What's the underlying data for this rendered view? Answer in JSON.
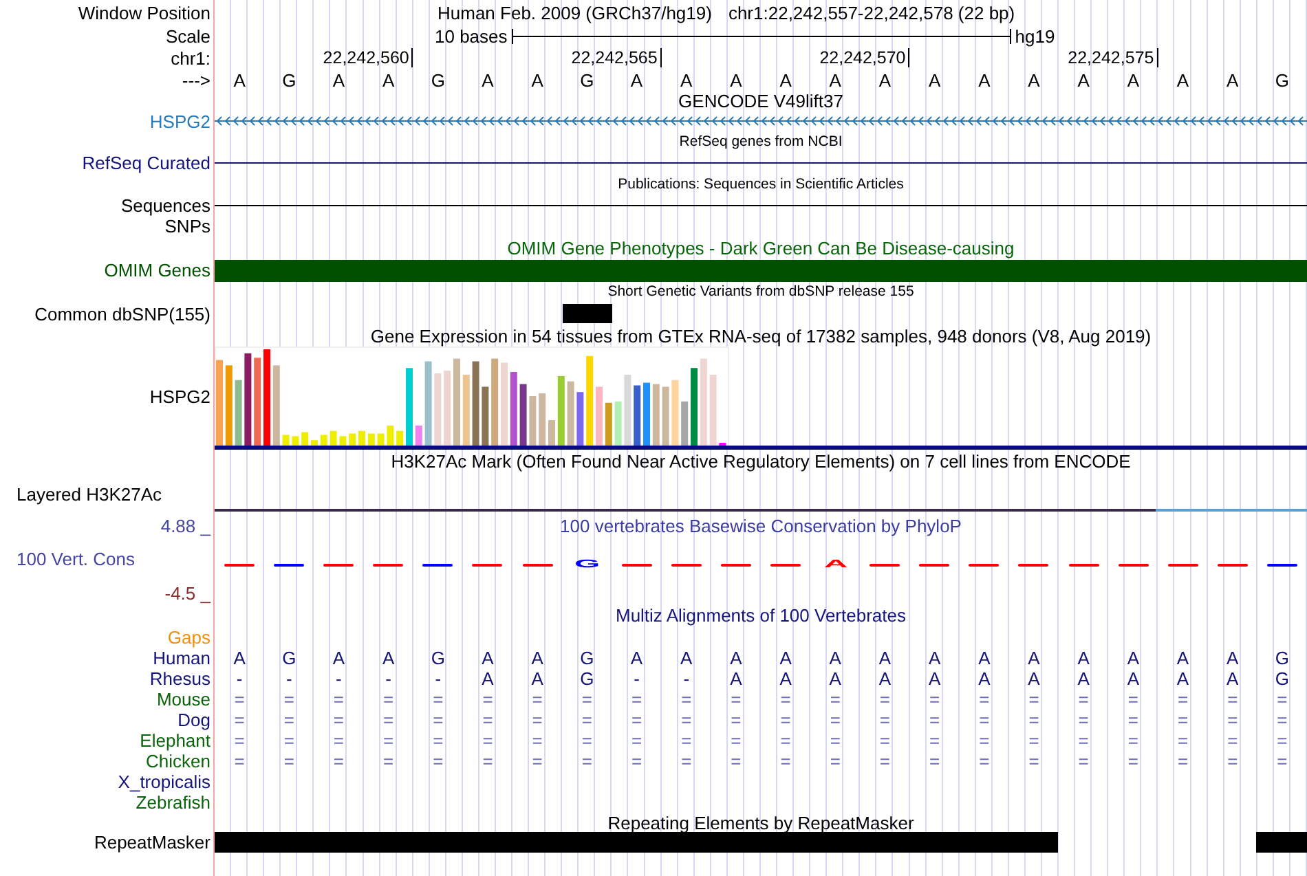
{
  "header": {
    "window_position": {
      "label": "Window Position",
      "assembly": "Human Feb. 2009 (GRCh37/hg19)",
      "position": "chr1:22,242,557-22,242,578 (22 bp)"
    },
    "scale": {
      "label": "Scale",
      "span": "10 bases",
      "db": "hg19"
    },
    "ruler": {
      "label": "chr1:",
      "ticks": [
        "22,242,560",
        "22,242,565",
        "22,242,570",
        "22,242,575"
      ]
    },
    "sequence": {
      "label": "--->",
      "bases": [
        "A",
        "G",
        "A",
        "A",
        "G",
        "A",
        "A",
        "G",
        "A",
        "A",
        "A",
        "A",
        "A",
        "A",
        "A",
        "A",
        "A",
        "A",
        "A",
        "A",
        "A",
        "G"
      ]
    }
  },
  "tracks": [
    {
      "kind": "gene",
      "title": "GENCODE V49lift37",
      "label": "HSPG2",
      "color": "#2a7ab8"
    },
    {
      "kind": "line",
      "title": "RefSeq genes from NCBI",
      "label": "RefSeq Curated",
      "color": "#14147a"
    },
    {
      "kind": "line",
      "title": "Publications: Sequences in Scientific Articles",
      "label": "Sequences",
      "color": "#000000"
    },
    {
      "kind": "empty",
      "label": "SNPs",
      "color": "#000000"
    },
    {
      "kind": "bar",
      "title": "OMIM Gene Phenotypes - Dark Green Can Be Disease-causing",
      "label": "OMIM Genes",
      "color": "#005000"
    },
    {
      "kind": "snp",
      "title": "Short Genetic Variants from dbSNP release 155",
      "label": "Common dbSNP(155)",
      "color": "#000000"
    },
    {
      "kind": "gtex",
      "title": "Gene Expression in 54 tissues from GTEx RNA-seq of 17382 samples, 948 donors (V8, Aug 2019)",
      "label": "HSPG2",
      "color": "#000000"
    },
    {
      "kind": "signal",
      "title": "H3K27Ac Mark (Often Found Near Active Regulatory Elements) on 7 cell lines from ENCODE",
      "label": "Layered H3K27Ac",
      "color": "#000000"
    },
    {
      "kind": "conservation",
      "title": "100 vertebrates Basewise Conservation by PhyloP",
      "label": "100 Vert. Cons",
      "color": "#4646a0",
      "max_label": "4.88 _",
      "min_label": "-4.5 _",
      "bases": [
        {
          "kind": "dash",
          "color": "#ff0000"
        },
        {
          "kind": "dash",
          "color": "#0000ff"
        },
        {
          "kind": "dash",
          "color": "#ff0000"
        },
        {
          "kind": "dash",
          "color": "#ff0000"
        },
        {
          "kind": "dash",
          "color": "#0000ff"
        },
        {
          "kind": "dash",
          "color": "#ff0000"
        },
        {
          "kind": "dash",
          "color": "#ff0000"
        },
        {
          "kind": "letter",
          "letter": "G",
          "color": "#0000ff"
        },
        {
          "kind": "dash",
          "color": "#ff0000"
        },
        {
          "kind": "dash",
          "color": "#ff0000"
        },
        {
          "kind": "dash",
          "color": "#ff0000"
        },
        {
          "kind": "dash",
          "color": "#ff0000"
        },
        {
          "kind": "letter",
          "letter": "A",
          "color": "#ff0000"
        },
        {
          "kind": "dash",
          "color": "#ff0000"
        },
        {
          "kind": "dash",
          "color": "#ff0000"
        },
        {
          "kind": "dash",
          "color": "#ff0000"
        },
        {
          "kind": "dash",
          "color": "#ff0000"
        },
        {
          "kind": "dash",
          "color": "#ff0000"
        },
        {
          "kind": "dash",
          "color": "#ff0000"
        },
        {
          "kind": "dash",
          "color": "#ff0000"
        },
        {
          "kind": "dash",
          "color": "#ff0000"
        },
        {
          "kind": "dash",
          "color": "#0000ff"
        }
      ]
    },
    {
      "kind": "alignment",
      "title": "Multiz Alignments of 100 Vertebrates",
      "species": [
        {
          "name": "Gaps",
          "color": "#f0900a"
        },
        {
          "name": "Human",
          "color": "#14147a",
          "kind": "sequence",
          "bases": [
            "A",
            "G",
            "A",
            "A",
            "G",
            "A",
            "A",
            "G",
            "A",
            "A",
            "A",
            "A",
            "A",
            "A",
            "A",
            "A",
            "A",
            "A",
            "A",
            "A",
            "A",
            "G"
          ]
        },
        {
          "name": "Rhesus",
          "color": "#14147a",
          "kind": "sequence",
          "bases": [
            "-",
            "-",
            "-",
            "-",
            "-",
            "A",
            "A",
            "G",
            "-",
            "-",
            "A",
            "A",
            "A",
            "A",
            "A",
            "A",
            "A",
            "A",
            "A",
            "A",
            "A",
            "G"
          ]
        },
        {
          "name": "Mouse",
          "color": "#0a640a",
          "kind": "match",
          "bases": [
            "=",
            "=",
            "=",
            "=",
            "=",
            "=",
            "=",
            "=",
            "=",
            "=",
            "=",
            "=",
            "=",
            "=",
            "=",
            "=",
            "=",
            "=",
            "=",
            "=",
            "=",
            "="
          ]
        },
        {
          "name": "Dog",
          "color": "#14147a",
          "kind": "match",
          "bases": [
            "=",
            "=",
            "=",
            "=",
            "=",
            "=",
            "=",
            "=",
            "=",
            "=",
            "=",
            "=",
            "=",
            "=",
            "=",
            "=",
            "=",
            "=",
            "=",
            "=",
            "=",
            "="
          ]
        },
        {
          "name": "Elephant",
          "color": "#0a640a",
          "kind": "match",
          "bases": [
            "=",
            "=",
            "=",
            "=",
            "=",
            "=",
            "=",
            "=",
            "=",
            "=",
            "=",
            "=",
            "=",
            "=",
            "=",
            "=",
            "=",
            "=",
            "=",
            "=",
            "=",
            "="
          ]
        },
        {
          "name": "Chicken",
          "color": "#0a640a",
          "kind": "match",
          "bases": [
            "=",
            "=",
            "=",
            "=",
            "=",
            "=",
            "=",
            "=",
            "=",
            "=",
            "=",
            "=",
            "=",
            "=",
            "=",
            "=",
            "=",
            "=",
            "=",
            "=",
            "=",
            "="
          ]
        },
        {
          "name": "X_tropicalis",
          "color": "#14147a"
        },
        {
          "name": "Zebrafish",
          "color": "#0a640a"
        }
      ]
    },
    {
      "kind": "repeat",
      "title": "Repeating Elements by RepeatMasker",
      "label": "RepeatMasker",
      "color": "#000000"
    }
  ]
}
